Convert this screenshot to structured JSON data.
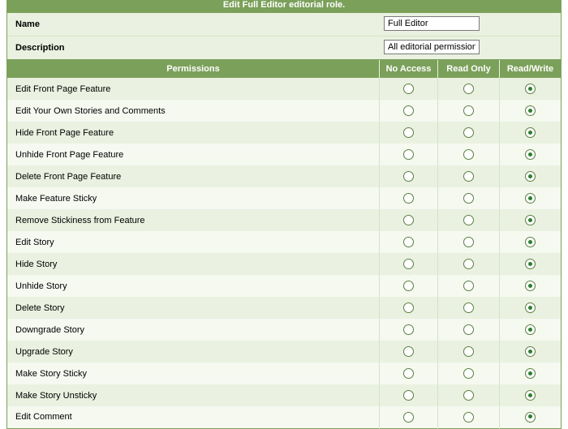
{
  "header_title": "Edit Full Editor editorial role.",
  "form": {
    "name_label": "Name",
    "name_value": "Full Editor",
    "description_label": "Description",
    "description_value": "All editorial permissions"
  },
  "columns": {
    "permissions": "Permissions",
    "no_access": "No Access",
    "read_only": "Read Only",
    "read_write": "Read/Write"
  },
  "permissions": [
    {
      "label": "Edit Front Page Feature",
      "value": "rw"
    },
    {
      "label": "Edit Your Own Stories and Comments",
      "value": "rw"
    },
    {
      "label": "Hide Front Page Feature",
      "value": "rw"
    },
    {
      "label": "Unhide Front Page Feature",
      "value": "rw"
    },
    {
      "label": "Delete Front Page Feature",
      "value": "rw"
    },
    {
      "label": "Make Feature Sticky",
      "value": "rw"
    },
    {
      "label": "Remove Stickiness from Feature",
      "value": "rw"
    },
    {
      "label": "Edit Story",
      "value": "rw"
    },
    {
      "label": "Hide Story",
      "value": "rw"
    },
    {
      "label": "Unhide Story",
      "value": "rw"
    },
    {
      "label": "Delete Story",
      "value": "rw"
    },
    {
      "label": "Downgrade Story",
      "value": "rw"
    },
    {
      "label": "Upgrade Story",
      "value": "rw"
    },
    {
      "label": "Make Story Sticky",
      "value": "rw"
    },
    {
      "label": "Make Story Unsticky",
      "value": "rw"
    },
    {
      "label": "Edit Comment",
      "value": "rw"
    }
  ]
}
